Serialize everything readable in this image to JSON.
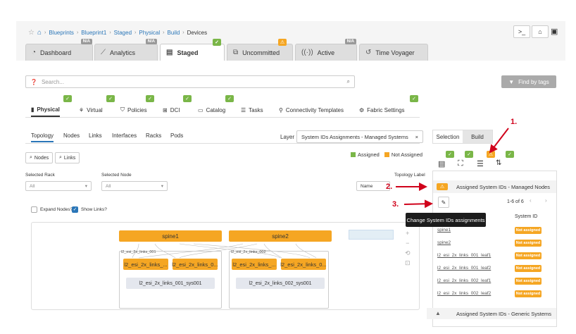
{
  "breadcrumb": [
    "Blueprints",
    "Blueprint1",
    "Staged",
    "Physical",
    "Build",
    "Devices"
  ],
  "top_tabs": [
    {
      "label": "Dashboard",
      "icon": "dashboard-icon",
      "badge": "N/A"
    },
    {
      "label": "Analytics",
      "icon": "chart-icon",
      "badge": "N/A"
    },
    {
      "label": "Staged",
      "icon": "document-icon",
      "badge": "✓"
    },
    {
      "label": "Uncommitted",
      "icon": "changes-icon",
      "badge": "⚠"
    },
    {
      "label": "Active",
      "icon": "broadcast-icon",
      "badge": "N/A"
    },
    {
      "label": "Time Voyager",
      "icon": "history-icon",
      "badge": ""
    }
  ],
  "toolbar": {
    "terminal": ">_",
    "home": "⌂",
    "lock": "🔒"
  },
  "search": {
    "placeholder": "Search..."
  },
  "find_by_tags": "Find by tags",
  "sub_tabs": [
    "Physical",
    "Virtual",
    "Policies",
    "DCI",
    "Catalog",
    "Tasks",
    "Connectivity Templates",
    "Fabric Settings"
  ],
  "view_tabs": [
    "Topology",
    "Nodes",
    "Links",
    "Interfaces",
    "Racks",
    "Pods"
  ],
  "layer": {
    "label": "Layer",
    "value": "System IDs Assignments - Managed Systems",
    "clear": "×"
  },
  "legend": {
    "assigned": "Assigned",
    "not_assigned": "Not Assigned",
    "assigned_color": "#7ab648",
    "not_assigned_color": "#f5a623"
  },
  "filters": {
    "nodes_btn": "Nodes",
    "links_btn": "Links",
    "selected_rack_label": "Selected Rack",
    "selected_rack_value": "All",
    "selected_node_label": "Selected Node",
    "selected_node_value": "All",
    "topology_label": "Topology Label",
    "topology_label_value": "Name"
  },
  "checks": {
    "expand_nodes": "Expand Nodes?",
    "show_links": "Show Links?"
  },
  "topology": {
    "spines": [
      "spine1",
      "spine2"
    ],
    "racks": [
      {
        "label": "l2_esi_2x_links_001",
        "leaves": [
          "l2_esi_2x_links_...",
          "l2_esi_2x_links_0..."
        ],
        "system": "l2_esi_2x_links_001_sys001"
      },
      {
        "label": "l2_esi_2x_links_002",
        "leaves": [
          "l2_esi_2x_links_...",
          "l2_esi_2x_links_0..."
        ],
        "system": "l2_esi_2x_links_002_sys001"
      }
    ]
  },
  "right": {
    "tabs": [
      "Selection",
      "Build"
    ],
    "section_title": "Assigned System IDs - Managed Nodes",
    "pager": "1-6 of 6",
    "col_system_id": "System ID",
    "rows": [
      {
        "name": "spine1",
        "status": "Not assigned"
      },
      {
        "name": "spine2",
        "status": "Not assigned"
      },
      {
        "name": "l2_esi_2x_links_001_leaf1",
        "status": "Not assigned"
      },
      {
        "name": "l2_esi_2x_links_001_leaf2",
        "status": "Not assigned"
      },
      {
        "name": "l2_esi_2x_links_002_leaf1",
        "status": "Not assigned"
      },
      {
        "name": "l2_esi_2x_links_002_leaf2",
        "status": "Not assigned"
      }
    ],
    "generic_title": "Assigned System IDs - Generic Systems"
  },
  "tooltip": "Change System IDs assignments",
  "annotations": [
    "1.",
    "2.",
    "3."
  ]
}
